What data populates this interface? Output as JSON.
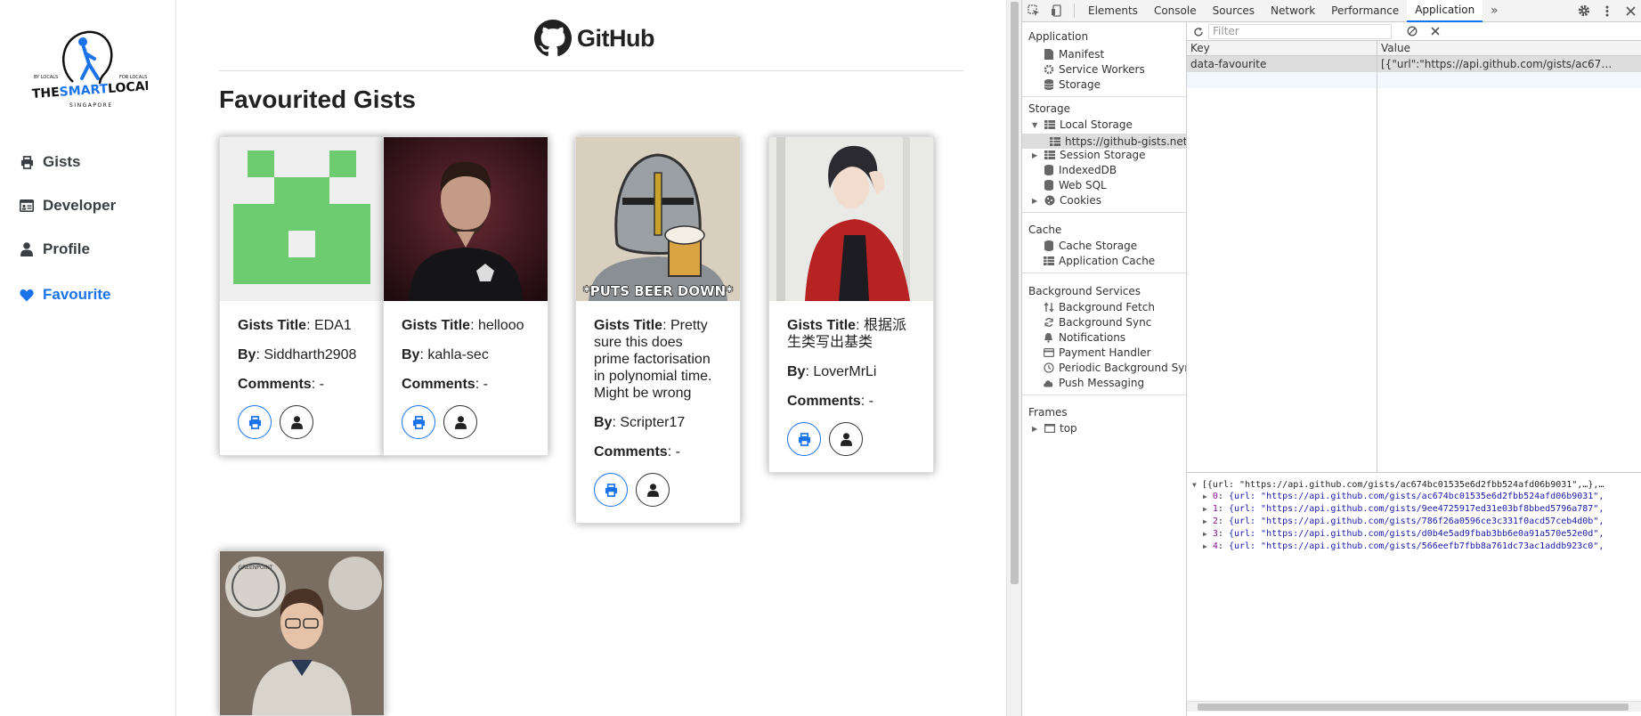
{
  "sidebar": {
    "logo": {
      "top_text_left": "BY LOCALS",
      "top_text_right": "FOR LOCALS",
      "brand": "THE SMART LOCAL",
      "brand_parts": [
        "THE",
        "SMART",
        "LOCAL"
      ],
      "sub": "SINGAPORE"
    },
    "items": [
      {
        "label": "Gists",
        "icon": "printer-icon",
        "active": false
      },
      {
        "label": "Developer",
        "icon": "id-card-icon",
        "active": false
      },
      {
        "label": "Profile",
        "icon": "user-icon",
        "active": false
      },
      {
        "label": "Favourite",
        "icon": "heart-icon",
        "active": true
      }
    ]
  },
  "header": {
    "brand": "GitHub",
    "brand_icon": "github-octocat-icon"
  },
  "main": {
    "title": "Favourited Gists",
    "title_label": "Gists Title",
    "by_label": "By",
    "comments_label": "Comments",
    "cards": [
      {
        "title": "EDA1",
        "by": "Siddharth2908",
        "comments": "-",
        "image": "green-identicon"
      },
      {
        "title": "hellooo",
        "by": "kahla-sec",
        "comments": "-",
        "image": "man-photo"
      },
      {
        "title": "Pretty sure this does prime factorisation in polynomial time. Might be wrong",
        "by": "Scripter17",
        "comments": "-",
        "image": "knight-meme",
        "meme_caption": "*PUTS BEER DOWN*"
      },
      {
        "title": "根据派生类写出基类",
        "by": "LoverMrLi",
        "comments": "-",
        "image": "anime-drawing"
      },
      {
        "title": "",
        "by": "",
        "comments": "",
        "image": "man-cafe-photo",
        "cafe_sign": "GREENPOINT"
      }
    ]
  },
  "devtools": {
    "tabs": [
      "Elements",
      "Console",
      "Sources",
      "Network",
      "Performance",
      "Application"
    ],
    "active_tab": "Application",
    "sidebar": {
      "application_header": "Application",
      "application_items": [
        "Manifest",
        "Service Workers",
        "Storage"
      ],
      "storage_header": "Storage",
      "local_storage": "Local Storage",
      "local_storage_origin": "https://github-gists.net",
      "storage_items": [
        "Session Storage",
        "IndexedDB",
        "Web SQL",
        "Cookies"
      ],
      "cache_header": "Cache",
      "cache_items": [
        "Cache Storage",
        "Application Cache"
      ],
      "bg_header": "Background Services",
      "bg_items": [
        "Background Fetch",
        "Background Sync",
        "Notifications",
        "Payment Handler",
        "Periodic Background Sync",
        "Push Messaging"
      ],
      "frames_header": "Frames",
      "frames_top": "top"
    },
    "filter_placeholder": "Filter",
    "table": {
      "col_key": "Key",
      "col_value": "Value",
      "rows": [
        {
          "key": "data-favourite",
          "value": "[{\"url\":\"https://api.github.com/gists/ac67…"
        }
      ]
    },
    "preview": {
      "root": "[{url: \"https://api.github.com/gists/ac674bc01535e6d2fbb524afd06b9031\",…},…",
      "items": [
        {
          "index": "0",
          "text": "{url: \"https://api.github.com/gists/ac674bc01535e6d2fbb524afd06b9031\","
        },
        {
          "index": "1",
          "text": "{url: \"https://api.github.com/gists/9ee4725917ed31e03bf8bbed5796a787\","
        },
        {
          "index": "2",
          "text": "{url: \"https://api.github.com/gists/786f26a0596ce3c331f0acd57ceb4d0b\","
        },
        {
          "index": "3",
          "text": "{url: \"https://api.github.com/gists/d0b4e5ad9fbab3bb6e0a91a570e52e0d\","
        },
        {
          "index": "4",
          "text": "{url: \"https://api.github.com/gists/566eefb7fbb8a761dc73ac1addb923c0\","
        }
      ]
    }
  },
  "colors": {
    "accent": "#1a73e8",
    "identicon": "#6dcb70",
    "devtools_toolbar": "#f3f3f3"
  }
}
